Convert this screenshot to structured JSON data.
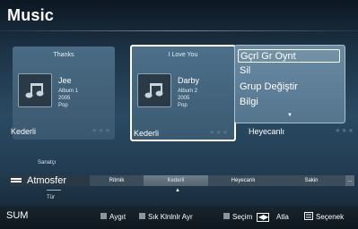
{
  "app": {
    "title": "Music"
  },
  "cards": [
    {
      "title": "Thanks",
      "artist": "Jee",
      "album": "Album 1",
      "year": "2005",
      "genre": "Pop",
      "mood": "Kederli",
      "stars": "★★★"
    },
    {
      "title": "I Love You",
      "artist": "Darby",
      "album": "Album 2",
      "year": "2005",
      "genre": "Pop",
      "mood": "Kederli",
      "stars": "★★★"
    }
  ],
  "third_mood": {
    "mood": "Heyecanlı",
    "stars": "★★★"
  },
  "popup": {
    "items": [
      "Gçrl Gr Oynt",
      "Sil",
      "Grup Değiştir",
      "Bilgi"
    ],
    "selected_index": 0,
    "more_arrow": "▼"
  },
  "sort": {
    "label_top": "Sanatçı",
    "current": "Atmosfer",
    "label_bottom": "Tür",
    "options": [
      "Ritmik",
      "Kederli",
      "Heyecanlı",
      "Sakin"
    ],
    "active_option": "Kederli",
    "more": "...",
    "caret": "▲"
  },
  "footer": {
    "sum": "SUM",
    "hints": [
      {
        "label": "Aygıt",
        "icon": "gray-square-icon"
      },
      {
        "label": "Sık Klnlnlr Ayr",
        "icon": "gray-square-icon"
      },
      {
        "label": "Seçim",
        "icon": "gray-square-icon"
      },
      {
        "label": "Atla",
        "icon": "skip-icon"
      },
      {
        "label": "Seçenek",
        "icon": "tools-icon"
      }
    ],
    "skip_glyphs": "◀▶"
  },
  "colors": {
    "accent_border": "#ffffff",
    "card_bg": "#4a6b84",
    "popup_bg": "#6a8ba3"
  }
}
